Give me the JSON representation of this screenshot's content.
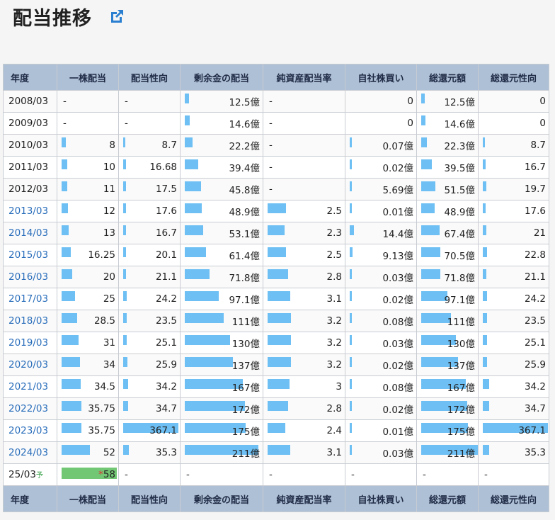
{
  "header": {
    "title": "配当推移",
    "icon": "external-link-icon"
  },
  "table": {
    "columns": [
      "年度",
      "一株配当",
      "配当性向",
      "剰余金の配当",
      "純資産配当率",
      "自社株買い",
      "総還元額",
      "総還元性向"
    ],
    "rows": [
      {
        "year": "2008/03",
        "link": false,
        "dps": "-",
        "payout": "-",
        "dividend": "12.5億",
        "ndr": "-",
        "buyback": "0",
        "total": "12.5億",
        "total_ratio": "0"
      },
      {
        "year": "2009/03",
        "link": false,
        "dps": "-",
        "payout": "-",
        "dividend": "14.6億",
        "ndr": "-",
        "buyback": "0",
        "total": "14.6億",
        "total_ratio": "0"
      },
      {
        "year": "2010/03",
        "link": false,
        "dps": "8",
        "payout": "8.7",
        "dividend": "22.2億",
        "ndr": "-",
        "buyback": "0.07億",
        "total": "22.3億",
        "total_ratio": "8.7"
      },
      {
        "year": "2011/03",
        "link": false,
        "dps": "10",
        "payout": "16.68",
        "dividend": "39.4億",
        "ndr": "-",
        "buyback": "0.02億",
        "total": "39.5億",
        "total_ratio": "16.7"
      },
      {
        "year": "2012/03",
        "link": false,
        "dps": "11",
        "payout": "17.5",
        "dividend": "45.8億",
        "ndr": "-",
        "buyback": "5.69億",
        "total": "51.5億",
        "total_ratio": "19.7"
      },
      {
        "year": "2013/03",
        "link": true,
        "dps": "12",
        "payout": "17.6",
        "dividend": "48.9億",
        "ndr": "2.5",
        "buyback": "0.01億",
        "total": "48.9億",
        "total_ratio": "17.6"
      },
      {
        "year": "2014/03",
        "link": true,
        "dps": "13",
        "payout": "16.7",
        "dividend": "53.1億",
        "ndr": "2.3",
        "buyback": "14.4億",
        "total": "67.4億",
        "total_ratio": "21"
      },
      {
        "year": "2015/03",
        "link": true,
        "dps": "16.25",
        "payout": "20.1",
        "dividend": "61.4億",
        "ndr": "2.5",
        "buyback": "9.13億",
        "total": "70.5億",
        "total_ratio": "22.8"
      },
      {
        "year": "2016/03",
        "link": true,
        "dps": "20",
        "payout": "21.1",
        "dividend": "71.8億",
        "ndr": "2.8",
        "buyback": "0.03億",
        "total": "71.8億",
        "total_ratio": "21.1"
      },
      {
        "year": "2017/03",
        "link": true,
        "dps": "25",
        "payout": "24.2",
        "dividend": "97.1億",
        "ndr": "3.1",
        "buyback": "0.02億",
        "total": "97.1億",
        "total_ratio": "24.2"
      },
      {
        "year": "2018/03",
        "link": true,
        "dps": "28.5",
        "payout": "23.5",
        "dividend": "111億",
        "ndr": "3.2",
        "buyback": "0.08億",
        "total": "111億",
        "total_ratio": "23.5"
      },
      {
        "year": "2019/03",
        "link": true,
        "dps": "31",
        "payout": "25.1",
        "dividend": "130億",
        "ndr": "3.2",
        "buyback": "0.03億",
        "total": "130億",
        "total_ratio": "25.1"
      },
      {
        "year": "2020/03",
        "link": true,
        "dps": "34",
        "payout": "25.9",
        "dividend": "137億",
        "ndr": "3.2",
        "buyback": "0.02億",
        "total": "137億",
        "total_ratio": "25.9"
      },
      {
        "year": "2021/03",
        "link": true,
        "dps": "34.5",
        "payout": "34.2",
        "dividend": "167億",
        "ndr": "3",
        "buyback": "0.08億",
        "total": "167億",
        "total_ratio": "34.2"
      },
      {
        "year": "2022/03",
        "link": true,
        "dps": "35.75",
        "payout": "34.7",
        "dividend": "172億",
        "ndr": "2.8",
        "buyback": "0.02億",
        "total": "172億",
        "total_ratio": "34.7"
      },
      {
        "year": "2023/03",
        "link": true,
        "dps": "35.75",
        "payout": "367.1",
        "dividend": "175億",
        "ndr": "2.4",
        "buyback": "0.01億",
        "total": "175億",
        "total_ratio": "367.1"
      },
      {
        "year": "2024/03",
        "link": true,
        "dps": "52",
        "payout": "35.3",
        "dividend": "211億",
        "ndr": "3.1",
        "buyback": "0.03億",
        "total": "211億",
        "total_ratio": "35.3"
      }
    ],
    "forecast": {
      "year": "25/03",
      "mark": "予",
      "star": "*",
      "dps": "58",
      "payout": "-",
      "dividend": "-",
      "ndr": "-",
      "buyback": "-",
      "total": "-",
      "total_ratio": "-"
    }
  },
  "colors": {
    "bar": "#6ec0f4",
    "forecast_bar": "#72c774",
    "header_bg": "#aec0d6",
    "link": "#2a6ebb"
  }
}
